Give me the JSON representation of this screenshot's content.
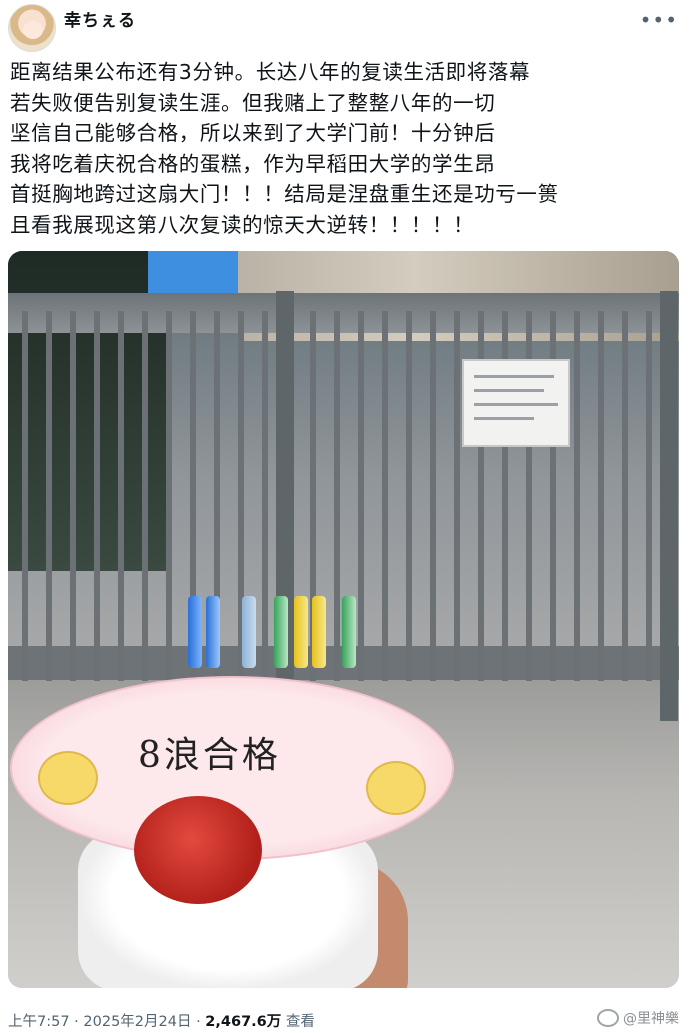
{
  "author": {
    "name": "幸ちぇる"
  },
  "post": {
    "lines": [
      "距离结果公布还有3分钟。长达八年的复读生活即将落幕",
      "若失败便告别复读生涯。但我赌上了整整八年的一切",
      "坚信自己能够合格，所以来到了大学门前！十分钟后",
      "我将吃着庆祝合格的蛋糕，作为早稻田大学的学生昂",
      "首挺胸地跨过这扇大门！！！结局是涅盘重生还是功亏一篑",
      "且看我展现这第八次复读的惊天大逆转！！！！！"
    ]
  },
  "photo": {
    "plate_text": "8浪合格"
  },
  "footer": {
    "time": "上午7:57",
    "separator": "·",
    "date": "2025年2月24日",
    "views": "2,467.6万",
    "views_label": "查看",
    "watermark": "@里神樂"
  },
  "icons": {
    "more": "more-dots-icon",
    "watermark": "weibo-icon"
  }
}
